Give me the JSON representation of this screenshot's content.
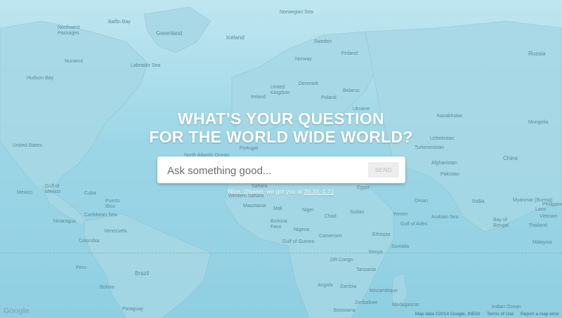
{
  "hero": {
    "line1": "WHAT’S YOUR QUESTION",
    "line2": "FOR THE WORLD WIDE WORLD?"
  },
  "search": {
    "placeholder": "Ask something good...",
    "value": "",
    "send_label": "SEND"
  },
  "status": {
    "prefix": "Nice, @javier, we got you at ",
    "coords": "39.33,-1.71"
  },
  "map": {
    "attribution": "Map data ©2014 Google, INEGI",
    "terms": "Terms of Use",
    "report": "Report a map error",
    "logo": "Google",
    "labels": [
      "Greenland",
      "Iceland",
      "Norwegian Sea",
      "Sweden",
      "Finland",
      "Norway",
      "Russia",
      "United Kingdom",
      "Ireland",
      "Denmark",
      "Poland",
      "Belarus",
      "Ukraine",
      "Portugal",
      "Kazakhstan",
      "Mongolia",
      "Uzbekistan",
      "Turkmenistan",
      "Afghanistan",
      "Pakistan",
      "India",
      "China",
      "Myanmar (Burma)",
      "Bay of Bengal",
      "Philippines",
      "Malaysia",
      "Vietnam",
      "Laos",
      "Thailand",
      "Indian Ocean",
      "Sudan",
      "Yemen",
      "Ethiopia",
      "Somalia",
      "Kenya",
      "Tanzania",
      "DR Congo",
      "Angola",
      "Zambia",
      "Zimbabwe",
      "Botswana",
      "Madagascar",
      "Mozambique",
      "Niger",
      "Chad",
      "Mali",
      "Mauritania",
      "Nigeria",
      "Burkina Faso",
      "Gulf of Guinea",
      "Gulf of Aden",
      "Arabian Sea",
      "Oman",
      "Cameroon",
      "Venezuela",
      "Colombia",
      "Peru",
      "Brazil",
      "Bolivia",
      "Paraguay",
      "Mexico",
      "United States",
      "Gulf of Mexico",
      "Caribbean Sea",
      "Cuba",
      "Puerto Rico",
      "Nicaragua",
      "Hudson Bay",
      "Labrador Sea",
      "Baffin Bay",
      "Nunavut",
      "Northwest Passages",
      "North Atlantic Ocean",
      "Sahara",
      "Western Sahara",
      "Egypt"
    ]
  }
}
